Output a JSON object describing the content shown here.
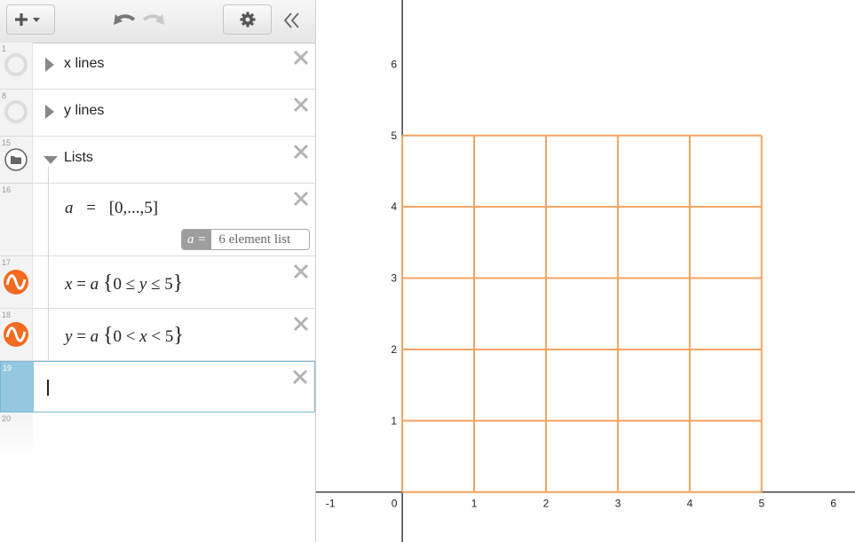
{
  "toolbar": {
    "add_icon": "plus-dropdown-icon",
    "undo_icon": "undo-icon",
    "redo_icon": "redo-icon",
    "settings_icon": "gear-icon",
    "collapse_icon": "double-chevron-left-icon"
  },
  "expressions": [
    {
      "num": "1",
      "type": "folder",
      "label": "x lines",
      "collapsed": true
    },
    {
      "num": "8",
      "type": "folder",
      "label": "y lines",
      "collapsed": true
    },
    {
      "num": "15",
      "type": "folder",
      "label": "Lists",
      "collapsed": false
    },
    {
      "num": "16",
      "type": "list",
      "lhs": "a",
      "rhs": "[0,...,5]",
      "eval_var": "a =",
      "eval_text": "6 element list"
    },
    {
      "num": "17",
      "type": "curve",
      "color": "#f26b21",
      "lhs": "x",
      "rhs": "a",
      "restriction_lo": "0",
      "op1": "≤",
      "var": "y",
      "op2": "≤",
      "restriction_hi": "5"
    },
    {
      "num": "18",
      "type": "curve",
      "color": "#f26b21",
      "lhs": "y",
      "rhs": "a",
      "restriction_lo": "0",
      "op1": "<",
      "var": "x",
      "op2": "<",
      "restriction_hi": "5"
    },
    {
      "num": "19",
      "type": "input",
      "value": ""
    },
    {
      "num": "20",
      "type": "empty"
    }
  ],
  "graph": {
    "x_ticks": [
      "-1",
      "0",
      "1",
      "2",
      "3",
      "4",
      "5",
      "6"
    ],
    "y_ticks": [
      "1",
      "2",
      "3",
      "4",
      "5",
      "6"
    ],
    "xlim": [
      -1.2,
      6.3
    ],
    "ylim": [
      -0.7,
      6.9
    ],
    "grid_lines": [
      0,
      1,
      2,
      3,
      4,
      5
    ],
    "grid_range": [
      0,
      5
    ],
    "line_color": "#f4a261"
  },
  "colors": {
    "accent": "#f26b21",
    "active_gutter": "#93c8e0",
    "active_border": "#7ab7d6"
  }
}
